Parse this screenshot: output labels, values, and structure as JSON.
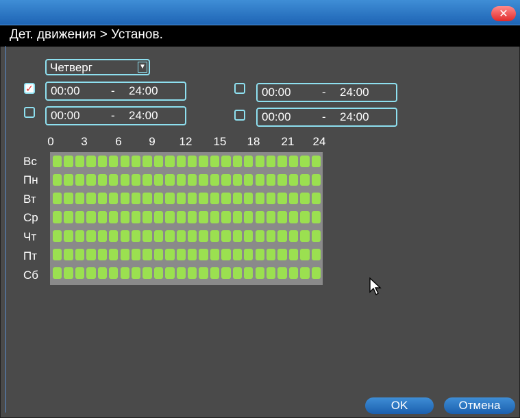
{
  "window": {
    "title": "Дет. движения > Установ."
  },
  "schedule": {
    "day_select": "Четверг",
    "periods": [
      {
        "checked": true,
        "start": "00:00",
        "sep": "-",
        "end": "24:00"
      },
      {
        "checked": false,
        "start": "00:00",
        "sep": "-",
        "end": "24:00"
      },
      {
        "checked": false,
        "start": "00:00",
        "sep": "-",
        "end": "24:00"
      },
      {
        "checked": false,
        "start": "00:00",
        "sep": "-",
        "end": "24:00"
      }
    ],
    "hour_labels": [
      "0",
      "3",
      "6",
      "9",
      "12",
      "15",
      "18",
      "21",
      "24"
    ],
    "day_labels": [
      "Вс",
      "Пн",
      "Вт",
      "Ср",
      "Чт",
      "Пт",
      "Сб"
    ],
    "cells_per_row": 24,
    "active_color": "#9be050"
  },
  "buttons": {
    "ok": "OK",
    "cancel": "Отмена"
  }
}
